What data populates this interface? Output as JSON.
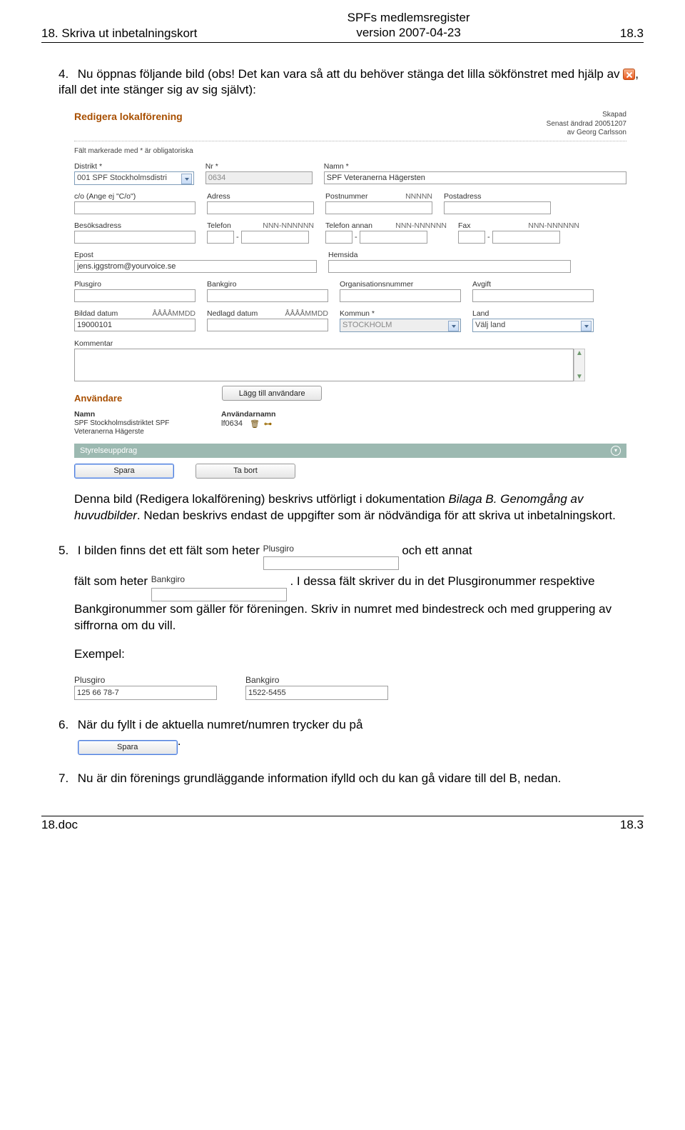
{
  "header": {
    "left": "18. Skriva ut inbetalningskort",
    "center_line1": "SPFs medlemsregister",
    "center_line2": "version 2007-04-23",
    "right": "18.3"
  },
  "items": {
    "i4": {
      "num": "4.",
      "lead": "Nu öppnas följande bild (obs! Det kan vara så att du behöver stänga det lilla sökfönstret med hjälp av ",
      "tail": ", ifall det inte stänger sig av sig självt):",
      "after1": "Denna bild (Redigera lokalförening) beskrivs utförligt i dokumentation ",
      "bilaga": "Bilaga B. Genomgång av huvudbilder",
      "after2": ". Nedan beskrivs endast de uppgifter som är nödvändiga för att skriva ut inbetalningskort."
    },
    "i5": {
      "num": "5.",
      "p1a": "I bilden finns det ett fält som heter ",
      "p1b": " och ett annat",
      "p2a": "fält som heter ",
      "p2b": ". I dessa fält skriver du in det Plusgironummer respektive Bankgironummer som gäller för föreningen. Skriv in numret med bindestreck och med gruppering av siffrorna om du vill.",
      "exempel": "Exempel:"
    },
    "i6": {
      "num": "6.",
      "text": "När du fyllt i de aktuella numret/numren trycker du på",
      "dot": "."
    },
    "i7": {
      "num": "7.",
      "text": "Nu är din förenings grundläggande information ifylld och du kan gå vidare till del B, nedan."
    }
  },
  "form": {
    "title": "Redigera lokalförening",
    "created": {
      "l1": "Skapad",
      "l2": "Senast ändrad 20051207",
      "l3": "av Georg Carlsson"
    },
    "hint": "Fält markerade med * är obligatoriska",
    "labels": {
      "distrikt": "Distrikt *",
      "nr": "Nr *",
      "namn": "Namn *",
      "co": "c/o (Ange ej \"C/o\")",
      "adress": "Adress",
      "postnr": "Postnummer",
      "postnr_hint": "NNNNN",
      "postadr": "Postadress",
      "besok": "Besöksadress",
      "tel": "Telefon",
      "tel_hint": "NNN-NNNNNN",
      "telannan": "Telefon annan",
      "telannan_hint": "NNN-NNNNNN",
      "fax": "Fax",
      "fax_hint": "NNN-NNNNNN",
      "epost": "Epost",
      "hemsida": "Hemsida",
      "plusgiro": "Plusgiro",
      "bankgiro": "Bankgiro",
      "orgnr": "Organisationsnummer",
      "avgift": "Avgift",
      "bildad": "Bildad datum",
      "bildad_hint": "ÅÅÅÅMMDD",
      "nedlagd": "Nedlagd datum",
      "nedlagd_hint": "ÅÅÅÅMMDD",
      "kommun": "Kommun *",
      "land": "Land",
      "kommentar": "Kommentar",
      "anvandare_section": "Användare",
      "add_user_btn": "Lägg till användare",
      "anv_namn": "Namn",
      "anv_user": "Användarnamn",
      "styrelse": "Styrelseuppdrag",
      "spara": "Spara",
      "tabort": "Ta bort"
    },
    "values": {
      "distrikt": "001 SPF Stockholmsdistri",
      "nr": "0634",
      "namn": "SPF Veteranerna Hägersten",
      "epost": "jens.iggstrom@yourvoice.se",
      "bildad": "19000101",
      "kommun": "STOCKHOLM",
      "land": "Välj land",
      "anv_namn_val": "SPF Stockholmsdistriktet SPF Veteranerna Hägerste",
      "anv_user_val": "lf0634"
    }
  },
  "inline_fields": {
    "plusgiro_label": "Plusgiro",
    "bankgiro_label": "Bankgiro"
  },
  "example": {
    "plusgiro_label": "Plusgiro",
    "plusgiro_val": "125 66 78-7",
    "bankgiro_label": "Bankgiro",
    "bankgiro_val": "1522-5455"
  },
  "footer": {
    "left": "18.doc",
    "right": "18.3"
  }
}
